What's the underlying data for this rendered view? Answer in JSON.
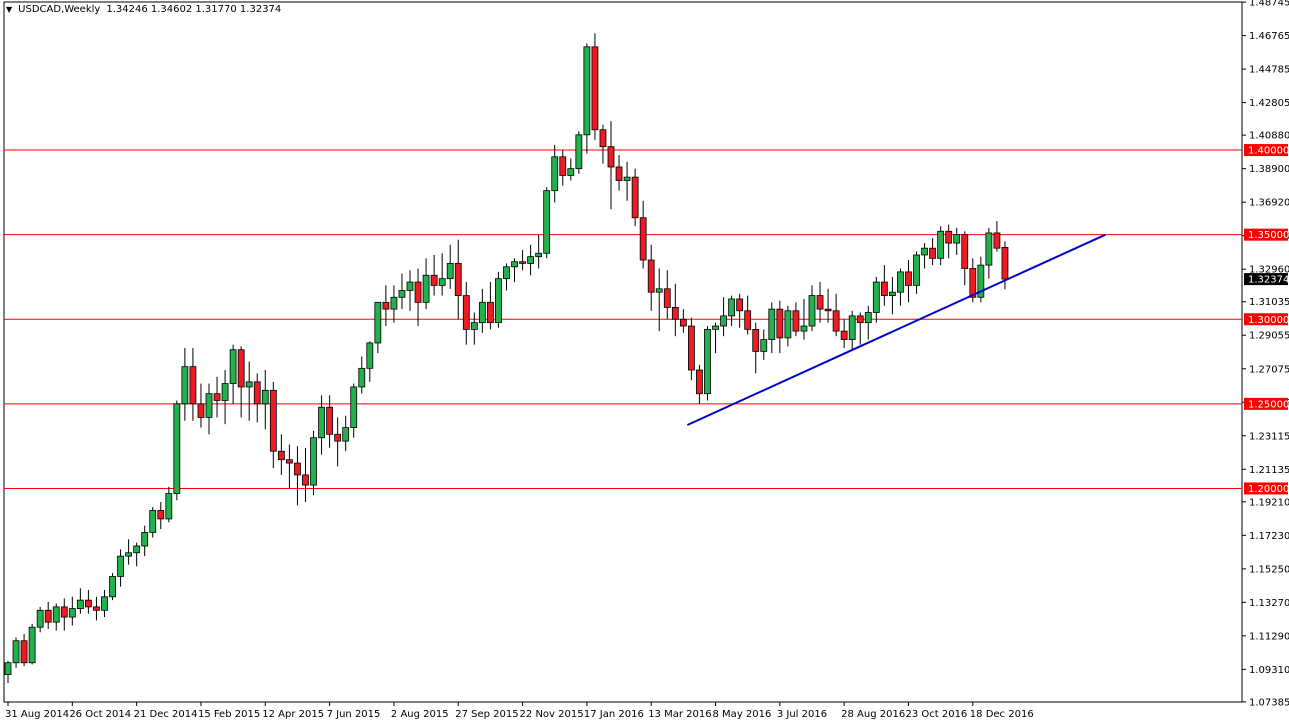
{
  "header": {
    "symbol": "USDCAD,Weekly",
    "ohlc": "1.34246 1.34602 1.31770 1.32374"
  },
  "colors": {
    "background": "#ffffff",
    "bull": "#22b14c",
    "bear": "#ed1c24",
    "wick": "#000000",
    "hline": "#ff0000",
    "trendline": "#0000cc",
    "axis_label_bg": "#ff0000",
    "price_label_bg": "#000000"
  },
  "chart_data": {
    "type": "candlestick",
    "title": "USDCAD,Weekly",
    "ylim": [
      1.0738,
      1.4875
    ],
    "y_ticks": [
      "1.48745",
      "1.46765",
      "1.44785",
      "1.42805",
      "1.40880",
      "1.38900",
      "1.36920",
      "1.34940",
      "1.32960",
      "1.31035",
      "1.29055",
      "1.27075",
      "1.25095",
      "1.23115",
      "1.21135",
      "1.19210",
      "1.17230",
      "1.15250",
      "1.13270",
      "1.11290",
      "1.09310",
      "1.07385"
    ],
    "x_labels": [
      {
        "label": "31 Aug 2014",
        "index": 0
      },
      {
        "label": "26 Oct 2014",
        "index": 8
      },
      {
        "label": "21 Dec 2014",
        "index": 16
      },
      {
        "label": "15 Feb 2015",
        "index": 24
      },
      {
        "label": "12 Apr 2015",
        "index": 32
      },
      {
        "label": "7 Jun 2015",
        "index": 40
      },
      {
        "label": "2 Aug 2015",
        "index": 48
      },
      {
        "label": "27 Sep 2015",
        "index": 56
      },
      {
        "label": "22 Nov 2015",
        "index": 64
      },
      {
        "label": "17 Jan 2016",
        "index": 72
      },
      {
        "label": "13 Mar 2016",
        "index": 80
      },
      {
        "label": "8 May 2016",
        "index": 88
      },
      {
        "label": "3 Jul 2016",
        "index": 96
      },
      {
        "label": "28 Aug 2016",
        "index": 104
      },
      {
        "label": "23 Oct 2016",
        "index": 112
      },
      {
        "label": "18 Dec 2016",
        "index": 120
      }
    ],
    "horizontal_lines": [
      {
        "price": 1.4,
        "label": "1.40000"
      },
      {
        "price": 1.35,
        "label": "1.35000"
      },
      {
        "price": 1.3,
        "label": "1.30000"
      },
      {
        "price": 1.25,
        "label": "1.25000"
      },
      {
        "price": 1.2,
        "label": "1.20000"
      }
    ],
    "current_price": {
      "price": 1.32374,
      "label": "1.32374"
    },
    "trendline": {
      "start": {
        "index": 84.5,
        "price": 1.2375
      },
      "end": {
        "index": 136.5,
        "price": 1.35
      }
    },
    "candles": [
      [
        1.09,
        1.098,
        1.085,
        1.097
      ],
      [
        1.097,
        1.112,
        1.094,
        1.11
      ],
      [
        1.11,
        1.114,
        1.095,
        1.097
      ],
      [
        1.097,
        1.12,
        1.096,
        1.118
      ],
      [
        1.118,
        1.13,
        1.115,
        1.128
      ],
      [
        1.128,
        1.133,
        1.117,
        1.121
      ],
      [
        1.121,
        1.132,
        1.116,
        1.13
      ],
      [
        1.13,
        1.135,
        1.116,
        1.124
      ],
      [
        1.124,
        1.136,
        1.119,
        1.129
      ],
      [
        1.129,
        1.141,
        1.126,
        1.134
      ],
      [
        1.134,
        1.14,
        1.126,
        1.13
      ],
      [
        1.13,
        1.136,
        1.122,
        1.128
      ],
      [
        1.128,
        1.14,
        1.124,
        1.136
      ],
      [
        1.136,
        1.15,
        1.134,
        1.148
      ],
      [
        1.148,
        1.164,
        1.142,
        1.16
      ],
      [
        1.16,
        1.17,
        1.155,
        1.162
      ],
      [
        1.162,
        1.168,
        1.154,
        1.166
      ],
      [
        1.166,
        1.178,
        1.16,
        1.174
      ],
      [
        1.174,
        1.189,
        1.171,
        1.187
      ],
      [
        1.187,
        1.192,
        1.176,
        1.182
      ],
      [
        1.182,
        1.201,
        1.18,
        1.197
      ],
      [
        1.197,
        1.252,
        1.193,
        1.25
      ],
      [
        1.25,
        1.283,
        1.24,
        1.272
      ],
      [
        1.272,
        1.283,
        1.24,
        1.25
      ],
      [
        1.25,
        1.262,
        1.236,
        1.242
      ],
      [
        1.242,
        1.262,
        1.232,
        1.256
      ],
      [
        1.256,
        1.266,
        1.242,
        1.252
      ],
      [
        1.252,
        1.27,
        1.238,
        1.262
      ],
      [
        1.262,
        1.285,
        1.25,
        1.282
      ],
      [
        1.282,
        1.284,
        1.242,
        1.26
      ],
      [
        1.26,
        1.275,
        1.24,
        1.263
      ],
      [
        1.263,
        1.268,
        1.239,
        1.25
      ],
      [
        1.25,
        1.27,
        1.235,
        1.258
      ],
      [
        1.258,
        1.263,
        1.212,
        1.222
      ],
      [
        1.222,
        1.232,
        1.208,
        1.217
      ],
      [
        1.217,
        1.226,
        1.2,
        1.215
      ],
      [
        1.215,
        1.225,
        1.19,
        1.208
      ],
      [
        1.208,
        1.224,
        1.192,
        1.202
      ],
      [
        1.202,
        1.234,
        1.196,
        1.23
      ],
      [
        1.23,
        1.255,
        1.22,
        1.248
      ],
      [
        1.248,
        1.255,
        1.224,
        1.232
      ],
      [
        1.232,
        1.242,
        1.213,
        1.228
      ],
      [
        1.228,
        1.243,
        1.222,
        1.236
      ],
      [
        1.236,
        1.262,
        1.23,
        1.26
      ],
      [
        1.26,
        1.278,
        1.256,
        1.271
      ],
      [
        1.271,
        1.287,
        1.263,
        1.286
      ],
      [
        1.286,
        1.31,
        1.28,
        1.31
      ],
      [
        1.31,
        1.32,
        1.296,
        1.306
      ],
      [
        1.306,
        1.32,
        1.298,
        1.313
      ],
      [
        1.313,
        1.327,
        1.306,
        1.317
      ],
      [
        1.317,
        1.329,
        1.305,
        1.322
      ],
      [
        1.322,
        1.33,
        1.296,
        1.31
      ],
      [
        1.31,
        1.336,
        1.306,
        1.326
      ],
      [
        1.326,
        1.338,
        1.314,
        1.32
      ],
      [
        1.32,
        1.339,
        1.314,
        1.324
      ],
      [
        1.324,
        1.344,
        1.318,
        1.333
      ],
      [
        1.333,
        1.347,
        1.3,
        1.314
      ],
      [
        1.314,
        1.322,
        1.285,
        1.294
      ],
      [
        1.294,
        1.304,
        1.285,
        1.298
      ],
      [
        1.298,
        1.318,
        1.292,
        1.31
      ],
      [
        1.31,
        1.322,
        1.294,
        1.298
      ],
      [
        1.298,
        1.328,
        1.295,
        1.324
      ],
      [
        1.324,
        1.333,
        1.317,
        1.331
      ],
      [
        1.331,
        1.336,
        1.322,
        1.334
      ],
      [
        1.334,
        1.341,
        1.329,
        1.333
      ],
      [
        1.333,
        1.344,
        1.326,
        1.337
      ],
      [
        1.337,
        1.35,
        1.33,
        1.339
      ],
      [
        1.339,
        1.378,
        1.336,
        1.376
      ],
      [
        1.376,
        1.403,
        1.369,
        1.396
      ],
      [
        1.396,
        1.4,
        1.379,
        1.385
      ],
      [
        1.385,
        1.395,
        1.382,
        1.389
      ],
      [
        1.389,
        1.411,
        1.386,
        1.409
      ],
      [
        1.409,
        1.463,
        1.398,
        1.461
      ],
      [
        1.461,
        1.469,
        1.406,
        1.412
      ],
      [
        1.412,
        1.415,
        1.392,
        1.402
      ],
      [
        1.402,
        1.417,
        1.365,
        1.39
      ],
      [
        1.39,
        1.397,
        1.376,
        1.382
      ],
      [
        1.382,
        1.393,
        1.37,
        1.384
      ],
      [
        1.384,
        1.389,
        1.355,
        1.36
      ],
      [
        1.36,
        1.37,
        1.33,
        1.335
      ],
      [
        1.335,
        1.344,
        1.305,
        1.316
      ],
      [
        1.316,
        1.33,
        1.293,
        1.318
      ],
      [
        1.318,
        1.329,
        1.3,
        1.307
      ],
      [
        1.307,
        1.321,
        1.29,
        1.3
      ],
      [
        1.3,
        1.306,
        1.292,
        1.296
      ],
      [
        1.296,
        1.301,
        1.264,
        1.27
      ],
      [
        1.27,
        1.273,
        1.25,
        1.256
      ],
      [
        1.256,
        1.296,
        1.252,
        1.294
      ],
      [
        1.294,
        1.298,
        1.28,
        1.296
      ],
      [
        1.296,
        1.313,
        1.29,
        1.302
      ],
      [
        1.302,
        1.314,
        1.296,
        1.312
      ],
      [
        1.312,
        1.315,
        1.295,
        1.305
      ],
      [
        1.305,
        1.314,
        1.291,
        1.294
      ],
      [
        1.294,
        1.298,
        1.268,
        1.281
      ],
      [
        1.281,
        1.294,
        1.276,
        1.288
      ],
      [
        1.288,
        1.31,
        1.28,
        1.306
      ],
      [
        1.306,
        1.311,
        1.28,
        1.289
      ],
      [
        1.289,
        1.308,
        1.284,
        1.305
      ],
      [
        1.305,
        1.31,
        1.29,
        1.293
      ],
      [
        1.293,
        1.312,
        1.288,
        1.296
      ],
      [
        1.296,
        1.32,
        1.293,
        1.314
      ],
      [
        1.314,
        1.322,
        1.298,
        1.306
      ],
      [
        1.306,
        1.318,
        1.298,
        1.305
      ],
      [
        1.305,
        1.315,
        1.29,
        1.293
      ],
      [
        1.293,
        1.3,
        1.283,
        1.288
      ],
      [
        1.288,
        1.305,
        1.282,
        1.302
      ],
      [
        1.302,
        1.304,
        1.285,
        1.298
      ],
      [
        1.298,
        1.308,
        1.288,
        1.304
      ],
      [
        1.304,
        1.325,
        1.298,
        1.322
      ],
      [
        1.322,
        1.332,
        1.308,
        1.314
      ],
      [
        1.314,
        1.325,
        1.303,
        1.316
      ],
      [
        1.316,
        1.33,
        1.308,
        1.328
      ],
      [
        1.328,
        1.335,
        1.31,
        1.32
      ],
      [
        1.32,
        1.34,
        1.315,
        1.338
      ],
      [
        1.338,
        1.345,
        1.33,
        1.342
      ],
      [
        1.342,
        1.348,
        1.332,
        1.336
      ],
      [
        1.336,
        1.355,
        1.332,
        1.352
      ],
      [
        1.352,
        1.356,
        1.336,
        1.345
      ],
      [
        1.345,
        1.354,
        1.338,
        1.35
      ],
      [
        1.35,
        1.352,
        1.32,
        1.33
      ],
      [
        1.33,
        1.336,
        1.31,
        1.313
      ],
      [
        1.313,
        1.337,
        1.31,
        1.332
      ],
      [
        1.332,
        1.354,
        1.324,
        1.351
      ],
      [
        1.351,
        1.358,
        1.34,
        1.342
      ],
      [
        1.34246,
        1.34602,
        1.3177,
        1.32374
      ]
    ]
  }
}
